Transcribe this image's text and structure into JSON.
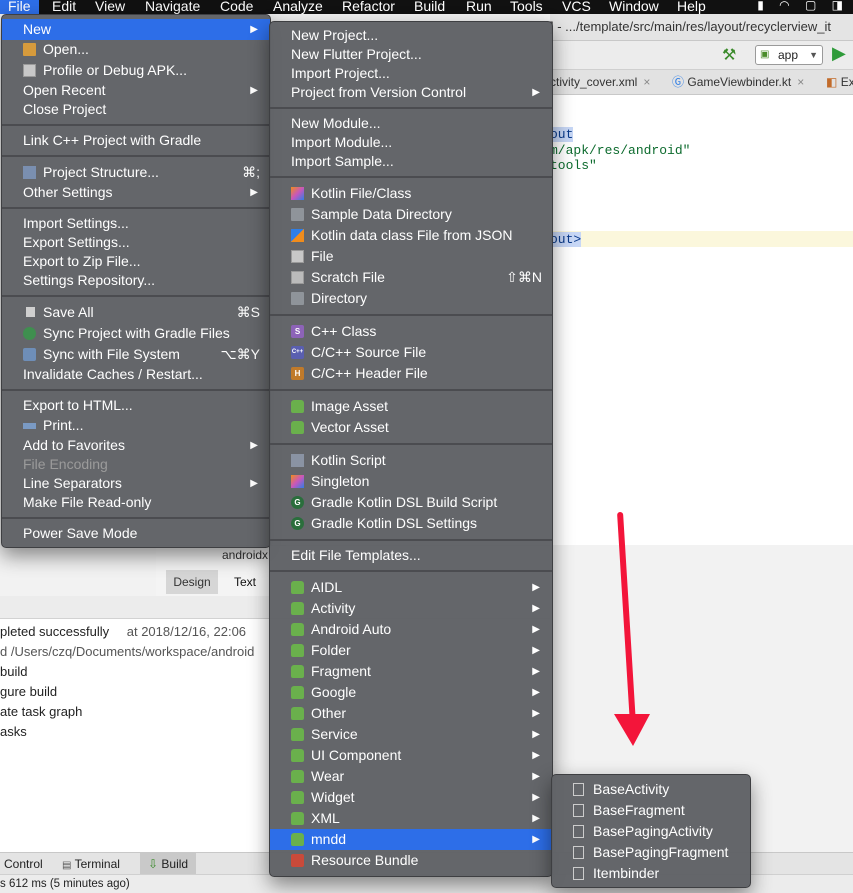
{
  "menubar": {
    "items": [
      "File",
      "Edit",
      "View",
      "Navigate",
      "Code",
      "Analyze",
      "Refactor",
      "Build",
      "Run",
      "Tools",
      "VCS",
      "Window",
      "Help"
    ],
    "status_icons": "▮ ◠ ▢ ◨"
  },
  "window": {
    "title": "] - .../template/src/main/res/layout/recyclerview_it",
    "run_config": "app",
    "tabs": [
      {
        "label": "ctivity_cover.xml"
      },
      {
        "label": "GameViewbinder.kt"
      },
      {
        "label": "Ex"
      }
    ]
  },
  "editor": {
    "lines": [
      {
        "text": "out"
      },
      {
        "text": "m/apk/res/android\""
      },
      {
        "text": "tools\""
      },
      {
        "text": "out>"
      }
    ],
    "bottom_text": "androidx",
    "design_tab": "Design",
    "text_tab": "Text"
  },
  "build": {
    "lines": [
      {
        "text": "pleted successfully",
        "time": "at 2018/12/16, 22:06"
      },
      {
        "text": "d  /Users/czq/Documents/workspace/android"
      },
      {
        "text": "build"
      },
      {
        "text": "gure build"
      },
      {
        "text": "ate task graph"
      },
      {
        "text": "asks"
      }
    ]
  },
  "bottom_tabs": {
    "version_control": "Control",
    "terminal": "Terminal",
    "build": "Build"
  },
  "status_bar": {
    "text": "s 612 ms (5 minutes ago)"
  },
  "file_menu": {
    "items": [
      {
        "label": "New",
        "arrow": true,
        "selected": true
      },
      {
        "label": "Open...",
        "icon": "folder-icon"
      },
      {
        "label": "Profile or Debug APK...",
        "icon": "apk-icon"
      },
      {
        "label": "Open Recent",
        "arrow": true
      },
      {
        "label": "Close Project"
      },
      {
        "label": "Link C++ Project with Gradle"
      },
      {
        "label": "Project Structure...",
        "icon": "project-structure-icon",
        "shortcut": "⌘;"
      },
      {
        "label": "Other Settings",
        "arrow": true
      },
      {
        "label": "Import Settings..."
      },
      {
        "label": "Export Settings..."
      },
      {
        "label": "Export to Zip File..."
      },
      {
        "label": "Settings Repository..."
      },
      {
        "label": "Save All",
        "icon": "save-icon",
        "shortcut": "⌘S"
      },
      {
        "label": "Sync Project with Gradle Files",
        "icon": "sync-gradle-icon"
      },
      {
        "label": "Sync with File System",
        "icon": "sync-icon",
        "shortcut": "⌥⌘Y"
      },
      {
        "label": "Invalidate Caches / Restart..."
      },
      {
        "label": "Export to HTML..."
      },
      {
        "label": "Print...",
        "icon": "print-icon"
      },
      {
        "label": "Add to Favorites",
        "arrow": true
      },
      {
        "label": "File Encoding",
        "disabled": true
      },
      {
        "label": "Line Separators",
        "arrow": true
      },
      {
        "label": "Make File Read-only"
      },
      {
        "label": "Power Save Mode"
      }
    ]
  },
  "new_menu": {
    "items": [
      {
        "label": "New Project..."
      },
      {
        "label": "New Flutter Project..."
      },
      {
        "label": "Import Project..."
      },
      {
        "label": "Project from Version Control",
        "arrow": true
      },
      {
        "label": "New Module..."
      },
      {
        "label": "Import Module..."
      },
      {
        "label": "Import Sample..."
      },
      {
        "label": "Kotlin File/Class",
        "icon": "kotlin-icon"
      },
      {
        "label": "Sample Data Directory",
        "icon": "folder-icon"
      },
      {
        "label": "Kotlin data class File from JSON",
        "icon": "json-kotlin-icon"
      },
      {
        "label": "File",
        "icon": "file-icon"
      },
      {
        "label": "Scratch File",
        "icon": "scratch-file-icon",
        "shortcut": "⇧⌘N"
      },
      {
        "label": "Directory",
        "icon": "folder-icon"
      },
      {
        "label": "C++ Class",
        "icon": "cpp-class-icon"
      },
      {
        "label": "C/C++ Source File",
        "icon": "cpp-source-icon"
      },
      {
        "label": "C/C++ Header File",
        "icon": "cpp-header-icon"
      },
      {
        "label": "Image Asset",
        "icon": "android-icon"
      },
      {
        "label": "Vector Asset",
        "icon": "android-icon"
      },
      {
        "label": "Kotlin Script",
        "icon": "kotlin-script-icon"
      },
      {
        "label": "Singleton",
        "icon": "kotlin-icon"
      },
      {
        "label": "Gradle Kotlin DSL Build Script",
        "icon": "gradle-icon"
      },
      {
        "label": "Gradle Kotlin DSL Settings",
        "icon": "gradle-icon"
      },
      {
        "label": "Edit File Templates..."
      },
      {
        "label": "AIDL",
        "icon": "android-icon",
        "arrow": true
      },
      {
        "label": "Activity",
        "icon": "android-icon",
        "arrow": true
      },
      {
        "label": "Android Auto",
        "icon": "android-icon",
        "arrow": true
      },
      {
        "label": "Folder",
        "icon": "android-icon",
        "arrow": true
      },
      {
        "label": "Fragment",
        "icon": "android-icon",
        "arrow": true
      },
      {
        "label": "Google",
        "icon": "android-icon",
        "arrow": true
      },
      {
        "label": "Other",
        "icon": "android-icon",
        "arrow": true
      },
      {
        "label": "Service",
        "icon": "android-icon",
        "arrow": true
      },
      {
        "label": "UI Component",
        "icon": "android-icon",
        "arrow": true
      },
      {
        "label": "Wear",
        "icon": "android-icon",
        "arrow": true
      },
      {
        "label": "Widget",
        "icon": "android-icon",
        "arrow": true
      },
      {
        "label": "XML",
        "icon": "android-icon",
        "arrow": true
      },
      {
        "label": "mndd",
        "icon": "android-icon",
        "arrow": true,
        "selected": true
      },
      {
        "label": "Resource Bundle",
        "icon": "resource-bundle-icon"
      }
    ]
  },
  "mndd_menu": {
    "items": [
      {
        "label": "BaseActivity",
        "icon": "android-file-icon"
      },
      {
        "label": "BaseFragment",
        "icon": "android-file-icon"
      },
      {
        "label": "BasePagingActivity",
        "icon": "android-file-icon"
      },
      {
        "label": "BasePagingFragment",
        "icon": "android-file-icon"
      },
      {
        "label": "Itembinder",
        "icon": "android-file-icon"
      }
    ]
  },
  "colors": {
    "menu_bg": "#5f6165",
    "selection": "#2d6ee8",
    "annotation_arrow": "#f3153a"
  }
}
